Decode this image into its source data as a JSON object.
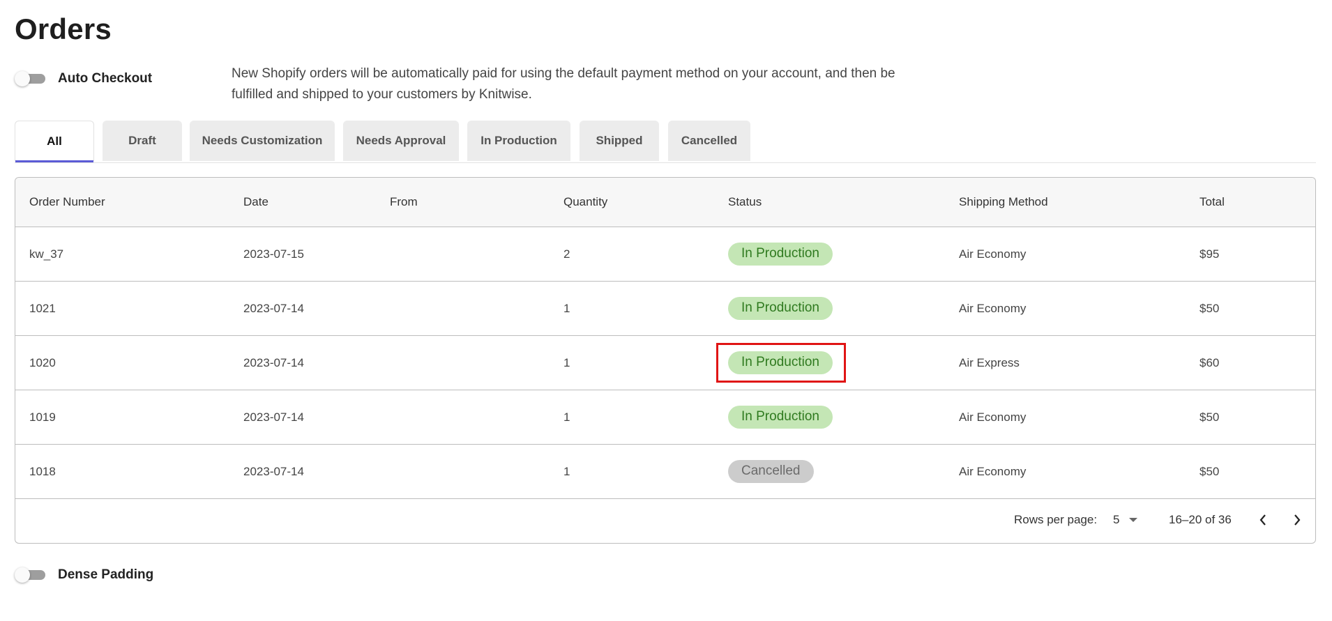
{
  "page": {
    "title": "Orders"
  },
  "auto_checkout": {
    "label": "Auto Checkout",
    "enabled": false,
    "description": "New Shopify orders will be automatically paid for using the default payment method on your account, and then be fulfilled and shipped to your customers by Knitwise."
  },
  "tabs": [
    {
      "label": "All",
      "active": true
    },
    {
      "label": "Draft",
      "active": false
    },
    {
      "label": "Needs Customization",
      "active": false
    },
    {
      "label": "Needs Approval",
      "active": false
    },
    {
      "label": "In Production",
      "active": false
    },
    {
      "label": "Shipped",
      "active": false
    },
    {
      "label": "Cancelled",
      "active": false
    }
  ],
  "table": {
    "columns": [
      "Order Number",
      "Date",
      "From",
      "Quantity",
      "Status",
      "Shipping Method",
      "Total"
    ],
    "rows": [
      {
        "order": "kw_37",
        "date": "2023-07-15",
        "from": "",
        "quantity": "2",
        "status": "In Production",
        "shipping": "Air Economy",
        "total": "$95"
      },
      {
        "order": "1021",
        "date": "2023-07-14",
        "from": "",
        "quantity": "1",
        "status": "In Production",
        "shipping": "Air Economy",
        "total": "$50"
      },
      {
        "order": "1020",
        "date": "2023-07-14",
        "from": "",
        "quantity": "1",
        "status": "In Production",
        "shipping": "Air Express",
        "total": "$60"
      },
      {
        "order": "1019",
        "date": "2023-07-14",
        "from": "",
        "quantity": "1",
        "status": "In Production",
        "shipping": "Air Economy",
        "total": "$50"
      },
      {
        "order": "1018",
        "date": "2023-07-14",
        "from": "",
        "quantity": "1",
        "status": "Cancelled",
        "shipping": "Air Economy",
        "total": "$50"
      }
    ],
    "highlighted_row": 2
  },
  "pagination": {
    "rows_per_page_label": "Rows per page:",
    "rows_per_page": "5",
    "range": "16–20 of 36",
    "prev_icon": "chevron-left-icon",
    "next_icon": "chevron-right-icon"
  },
  "dense_padding": {
    "label": "Dense Padding",
    "enabled": false
  },
  "colors": {
    "accent": "#5b5bd6",
    "in_production_bg": "#c4e6b5",
    "in_production_text": "#2f7a1f",
    "cancelled_bg": "#cccccc",
    "cancelled_text": "#6b6b6b",
    "highlight_border": "#e01414"
  }
}
